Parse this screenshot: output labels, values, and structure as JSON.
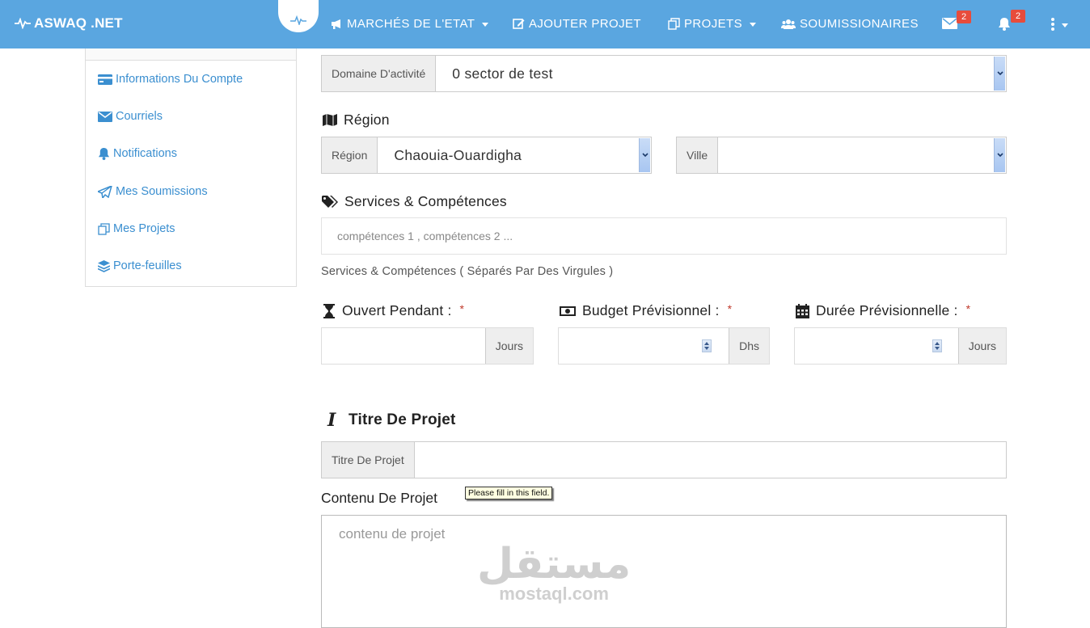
{
  "navbar": {
    "brand": "ASWAQ .NET",
    "items": [
      {
        "label": "MARCHÉS DE L'ETAT",
        "icon": "megaphone-icon"
      },
      {
        "label": "AJOUTER PROJET",
        "icon": "edit-icon"
      },
      {
        "label": "PROJETS",
        "icon": "copy-icon"
      },
      {
        "label": "SOUMISSIONAIRES",
        "icon": "users-icon"
      }
    ],
    "mail_badge": "2",
    "notif_badge": "2"
  },
  "sidebar": {
    "items": [
      {
        "label": "Informations Du Compte",
        "icon": "credit-card-icon"
      },
      {
        "label": "Courriels",
        "icon": "envelope-icon"
      },
      {
        "label": "Notifications",
        "icon": "bell-icon"
      },
      {
        "label": "Mes Soumissions",
        "icon": "paper-plane-icon"
      },
      {
        "label": "Mes Projets",
        "icon": "copy-icon"
      },
      {
        "label": "Porte-feuilles",
        "icon": "layers-icon"
      }
    ]
  },
  "form": {
    "domaine": {
      "addon": "Domaine D'activité",
      "value": "0 sector de test"
    },
    "region_heading": "Région",
    "region": {
      "addon": "Région",
      "value": "Chaouia-Ouardigha"
    },
    "ville": {
      "addon": "Ville",
      "value": ""
    },
    "services_heading": "Services & Compétences",
    "services_placeholder": "compétences 1 ,  compétences 2 ...",
    "services_help": "Services & Compétences ( Séparés Par Des Virgules )",
    "ouvert": {
      "label": "Ouvert Pendant :",
      "required": "*",
      "unit": "Jours"
    },
    "budget": {
      "label": "Budget Prévisionnel :",
      "required": "*",
      "unit": "Dhs"
    },
    "duree": {
      "label": "Durée Prévisionnelle :",
      "required": "*",
      "unit": "Jours"
    },
    "titre_heading": "Titre De Projet",
    "titre": {
      "addon": "Titre De Projet",
      "value": ""
    },
    "contenu_heading": "Contenu De Projet",
    "contenu_placeholder": "contenu de projet",
    "validation_tooltip": "Please fill in this field."
  },
  "watermark": {
    "arabic": "مستقل",
    "latin": "mostaql.com"
  },
  "colors": {
    "navbar": "#5aa6e0",
    "link": "#3b8fd0",
    "required": "#c0392b"
  }
}
